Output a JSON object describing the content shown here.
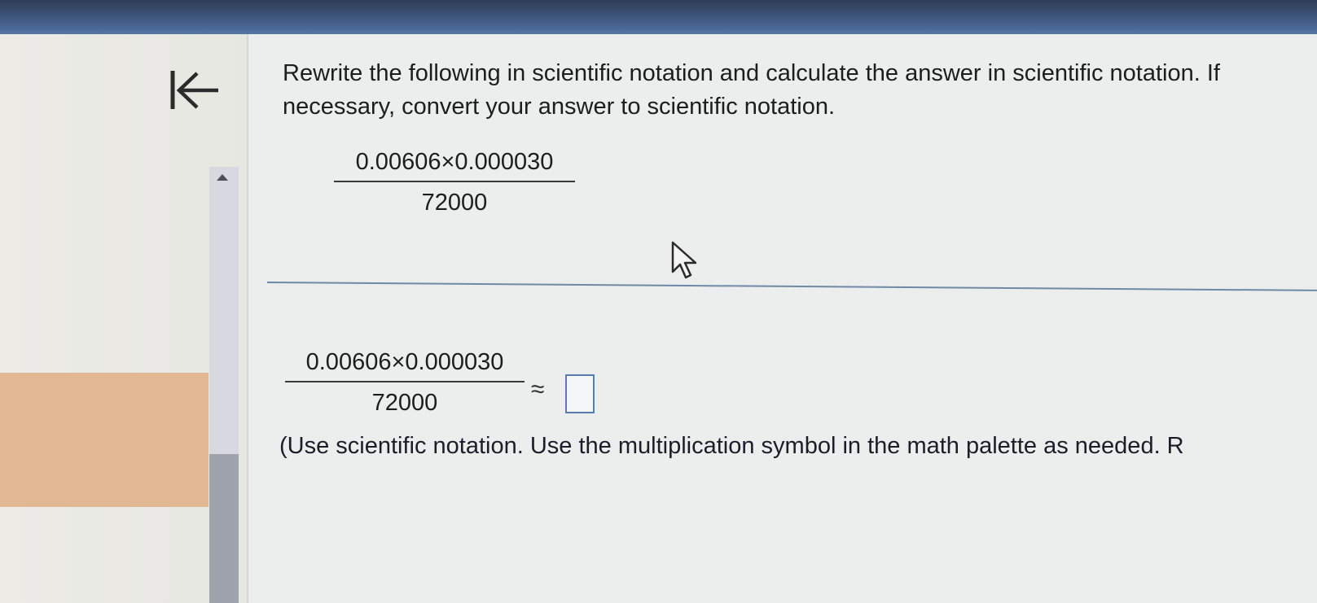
{
  "question": {
    "text": "Rewrite the following in scientific notation and calculate the answer in scientific notation. If necessary, convert your answer to scientific notation."
  },
  "expression": {
    "numerator": "0.00606×0.000030",
    "denominator": "72000"
  },
  "answer_row": {
    "numerator": "0.00606×0.000030",
    "denominator": "72000",
    "approx_symbol": "≈",
    "answer_value": ""
  },
  "instructions": {
    "text": "(Use scientific notation. Use the multiplication symbol in the math palette as needed. R"
  },
  "icons": {
    "back": "back-to-start-icon",
    "cursor": "mouse-pointer-icon",
    "scroll_up": "scroll-up-arrow-icon"
  },
  "colors": {
    "top_bar": "#3b5075",
    "answer_box_border": "#5a7bb0",
    "separator": "#6f8aa6",
    "left_highlight": "#e2b892"
  }
}
